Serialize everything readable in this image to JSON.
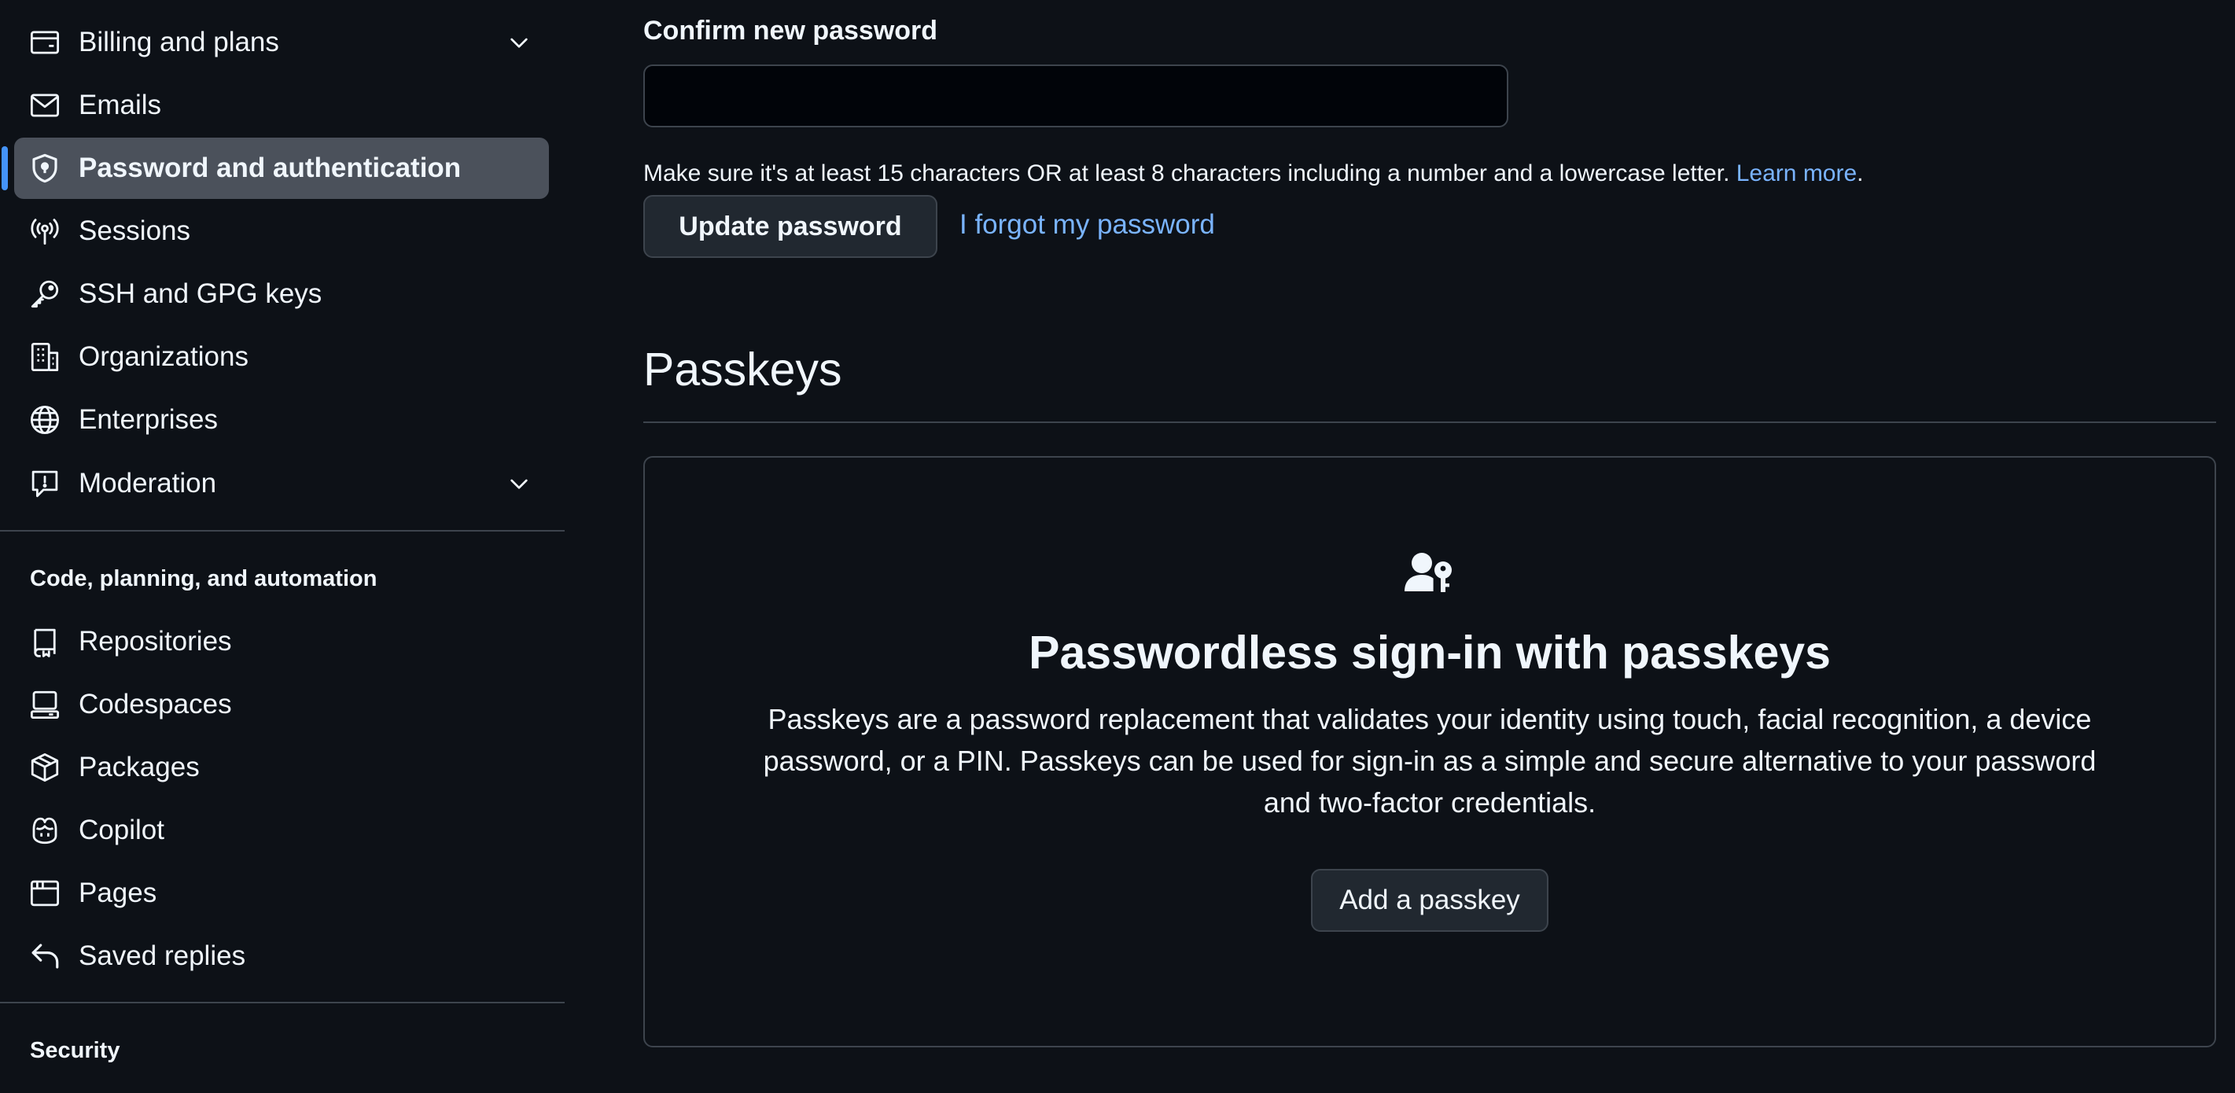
{
  "sidebar": {
    "items": [
      {
        "label": "Billing and plans",
        "icon": "credit-card-icon",
        "has_chevron": true
      },
      {
        "label": "Emails",
        "icon": "mail-icon"
      },
      {
        "label": "Password and authentication",
        "icon": "shield-lock-icon",
        "active": true
      },
      {
        "label": "Sessions",
        "icon": "broadcast-icon"
      },
      {
        "label": "SSH and GPG keys",
        "icon": "key-icon"
      },
      {
        "label": "Organizations",
        "icon": "organization-icon"
      },
      {
        "label": "Enterprises",
        "icon": "globe-icon"
      },
      {
        "label": "Moderation",
        "icon": "report-icon",
        "has_chevron": true
      }
    ],
    "section_code": {
      "heading": "Code, planning, and automation",
      "items": [
        {
          "label": "Repositories",
          "icon": "repo-icon"
        },
        {
          "label": "Codespaces",
          "icon": "codespaces-icon"
        },
        {
          "label": "Packages",
          "icon": "package-icon"
        },
        {
          "label": "Copilot",
          "icon": "copilot-icon"
        },
        {
          "label": "Pages",
          "icon": "browser-icon"
        },
        {
          "label": "Saved replies",
          "icon": "reply-icon"
        }
      ]
    },
    "section_security": {
      "heading": "Security"
    }
  },
  "main": {
    "confirm_label": "Confirm new password",
    "confirm_value": "",
    "hint_text": "Make sure it's at least 15 characters OR at least 8 characters including a number and a lowercase letter. ",
    "hint_link": "Learn more",
    "hint_period": ".",
    "update_button": "Update password",
    "forgot_link": "I forgot my password",
    "passkeys_title": "Passkeys",
    "blankslate": {
      "icon": "passkey-fill-icon",
      "title": "Passwordless sign-in with passkeys",
      "description": "Passkeys are a password replacement that validates your identity using touch, facial recognition, a device password, or a PIN. Passkeys can be used for sign-in as a simple and secure alternative to your password and two-factor credentials.",
      "button": "Add a passkey"
    }
  },
  "colors": {
    "background": "#0d1117",
    "text": "#f0f6fc",
    "border": "#3d444d",
    "link": "#4493f8",
    "active_item_bg": "#4b515b",
    "button_bg": "#212830"
  }
}
